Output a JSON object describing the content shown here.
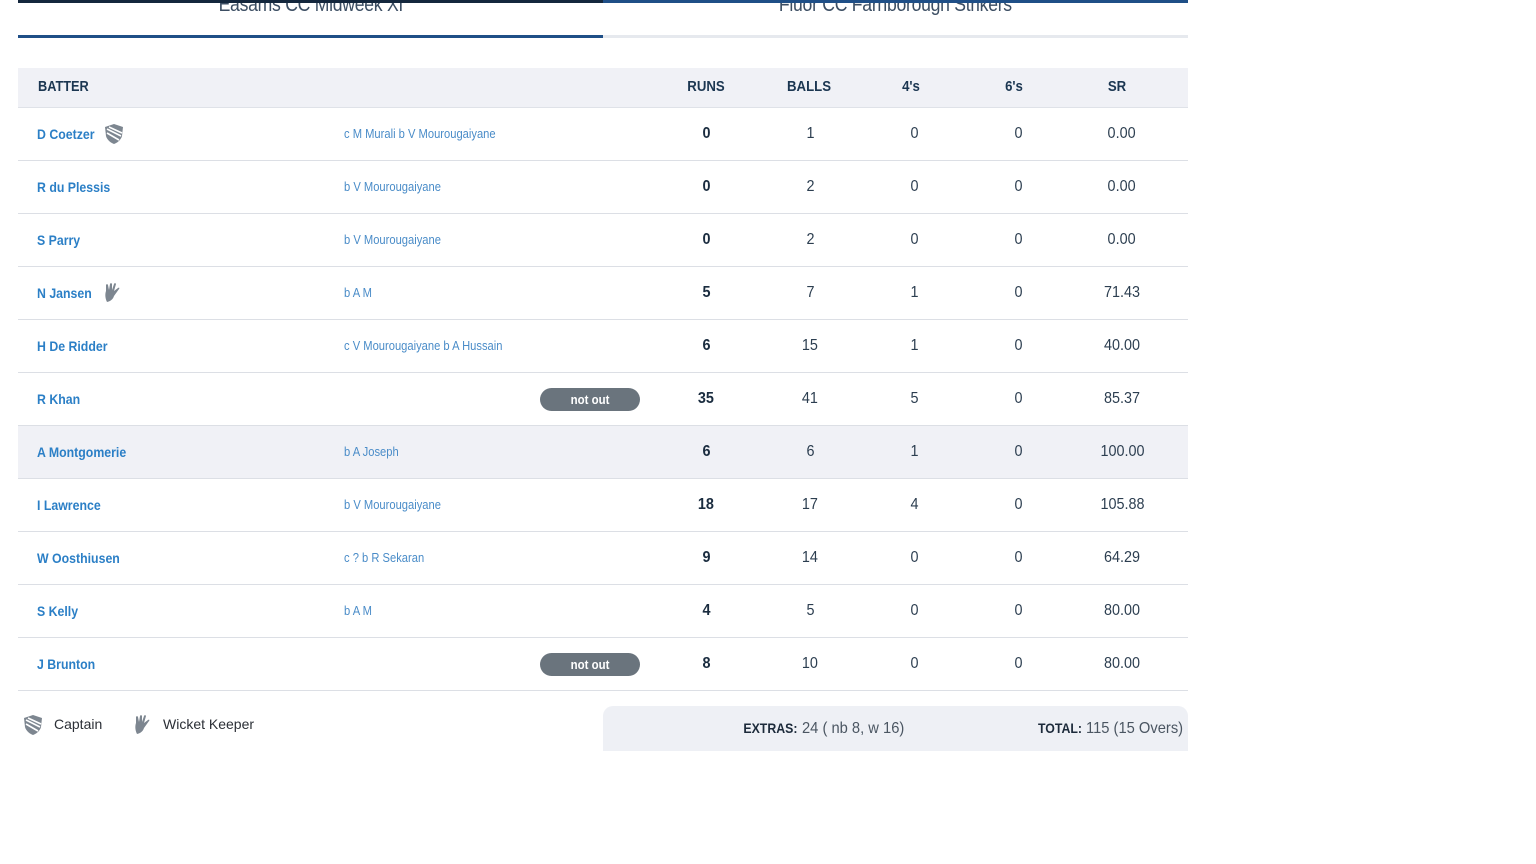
{
  "tabs": [
    {
      "label": "Easams CC Midweek XI",
      "active": true
    },
    {
      "label": "Fluor CC Farnborough Strikers",
      "active": false
    }
  ],
  "table": {
    "headers": {
      "batter": "BATTER",
      "runs": "RUNS",
      "balls": "BALLS",
      "fours": "4's",
      "sixes": "6's",
      "sr": "SR"
    },
    "rows": [
      {
        "name": "D Coetzer",
        "role_icon": "captain-shield-icon",
        "dismissal": "c M Murali b V Mourougaiyane",
        "runs": "0",
        "balls": "1",
        "fours": "0",
        "sixes": "0",
        "sr": "0.00"
      },
      {
        "name": "R du Plessis",
        "dismissal": "b V Mourougaiyane",
        "runs": "0",
        "balls": "2",
        "fours": "0",
        "sixes": "0",
        "sr": "0.00"
      },
      {
        "name": "S Parry",
        "dismissal": "b V Mourougaiyane",
        "runs": "0",
        "balls": "2",
        "fours": "0",
        "sixes": "0",
        "sr": "0.00"
      },
      {
        "name": "N Jansen",
        "role_icon": "wicket-keeper-gloves-icon",
        "dismissal": "b A M",
        "runs": "5",
        "balls": "7",
        "fours": "1",
        "sixes": "0",
        "sr": "71.43"
      },
      {
        "name": "H De Ridder",
        "dismissal": "c V Mourougaiyane b A Hussain",
        "runs": "6",
        "balls": "15",
        "fours": "1",
        "sixes": "0",
        "sr": "40.00"
      },
      {
        "name": "R Khan",
        "not_out": "not out",
        "runs": "35",
        "balls": "41",
        "fours": "5",
        "sixes": "0",
        "sr": "85.37"
      },
      {
        "name": "A Montgomerie",
        "dismissal": "b A Joseph",
        "runs": "6",
        "balls": "6",
        "fours": "1",
        "sixes": "0",
        "sr": "100.00",
        "highlighted": true
      },
      {
        "name": "I Lawrence",
        "dismissal": "b V Mourougaiyane",
        "runs": "18",
        "balls": "17",
        "fours": "4",
        "sixes": "0",
        "sr": "105.88"
      },
      {
        "name": "W Oosthiusen",
        "dismissal": "c ? b R Sekaran",
        "runs": "9",
        "balls": "14",
        "fours": "0",
        "sixes": "0",
        "sr": "64.29"
      },
      {
        "name": "S Kelly",
        "dismissal": "b A M",
        "runs": "4",
        "balls": "5",
        "fours": "0",
        "sixes": "0",
        "sr": "80.00"
      },
      {
        "name": "J Brunton",
        "not_out": "not out",
        "runs": "8",
        "balls": "10",
        "fours": "0",
        "sixes": "0",
        "sr": "80.00"
      }
    ]
  },
  "legend": {
    "captain": "Captain",
    "wicket_keeper": "Wicket Keeper"
  },
  "summary": {
    "extras_label": "EXTRAS:",
    "extras_value": "24 ( nb 8, w 16)",
    "total_label": "TOTAL:",
    "total_value": "115 (15 Overs)"
  },
  "colors": {
    "link": "#2b7fc6",
    "header_bg": "#f0f1f6",
    "tab_active": "#1f4f87",
    "badge": "#6a747d"
  }
}
